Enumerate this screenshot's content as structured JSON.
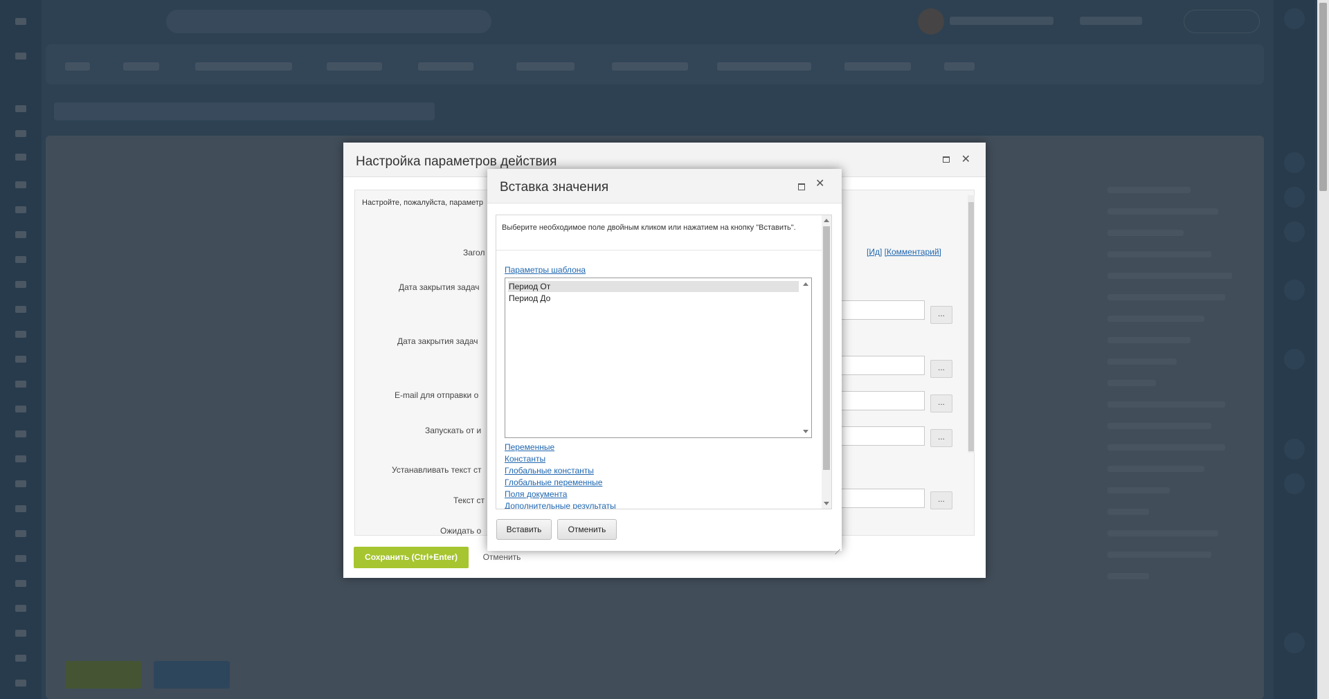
{
  "outer_dialog": {
    "title": "Настройка параметров действия",
    "hint": "Настройте, пожалуйста, параметр",
    "labels": [
      "Загол",
      "Дата закрытия задач",
      "Дата закрытия задач",
      "E-mail для отправки о",
      "Запускать от и",
      "Устанавливать текст ст",
      "Текст ст",
      "Ожидать о"
    ],
    "links": [
      "[Ид]",
      "[Комментарий]"
    ],
    "field_button": "...",
    "save_button": "Сохранить (Ctrl+Enter)",
    "cancel_button": "Отменить"
  },
  "insert_dialog": {
    "title": "Вставка значения",
    "description": "Выберите необходимое поле двойным кликом или нажатием на кнопку \"Вставить\".",
    "section_template_params": "Параметры шаблона",
    "list_options": [
      "Период От",
      "Период До"
    ],
    "selected_option": "Период От",
    "sections": [
      "Переменные",
      "Константы",
      "Глобальные константы",
      "Глобальные переменные",
      "Поля документа",
      "Дополнительные результаты"
    ],
    "insert_button": "Вставить",
    "cancel_button": "Отменить"
  },
  "colors": {
    "link": "#2067b0",
    "save_green": "#a6c530",
    "overlay": "#282d34"
  },
  "icons": {
    "maximize": "maximize-icon",
    "close": "close-icon"
  }
}
